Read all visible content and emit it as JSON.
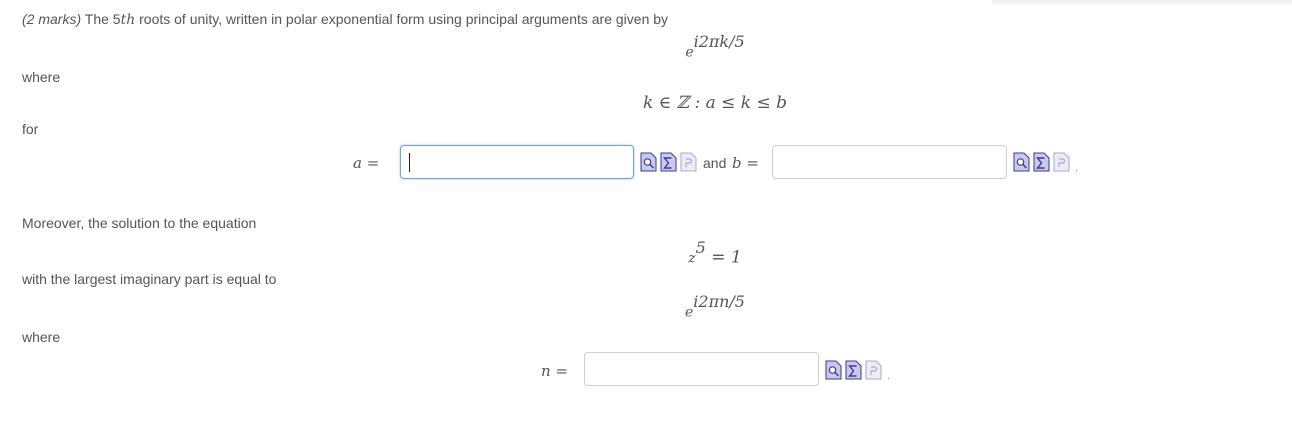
{
  "question": {
    "marks": "(2 marks)",
    "intro_before": "The 5",
    "intro_th": "th",
    "intro_after": " roots of unity, written in polar exponential form using principal arguments are given by",
    "expr1_base": "e",
    "expr1_exp": "i2πk/5",
    "where1": "where",
    "set_expr": "k ∈ ℤ : a ≤ k ≤ b",
    "for": "for",
    "a_label": "a =",
    "and_label": "and",
    "b_label": "b =",
    "moreover": "Moreover, the solution to the equation",
    "eq_base": "z",
    "eq_exp": "5",
    "eq_rest": " = 1",
    "largest": "with the largest imaginary part is equal to",
    "expr2_base": "e",
    "expr2_exp": "i2πn/5",
    "where2": "where",
    "n_label": "n ="
  },
  "inputs": {
    "a": {
      "value": "",
      "placeholder": ""
    },
    "b": {
      "value": "",
      "placeholder": ""
    },
    "n": {
      "value": "",
      "placeholder": ""
    }
  },
  "icons": [
    "preview-icon",
    "equation-editor-icon",
    "help-icon"
  ],
  "colors": {
    "text": "#555555",
    "focus_border": "#6aa5e0",
    "input_border": "#cfcfcf",
    "icon_fill": "#c9c8ee",
    "icon_stroke": "#3b3b8c"
  }
}
